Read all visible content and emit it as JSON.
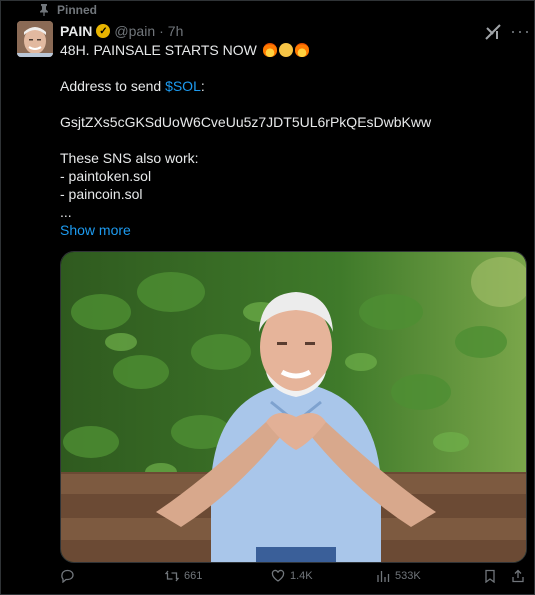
{
  "pinned": {
    "label": "Pinned"
  },
  "author": {
    "name": "PAIN",
    "handle": "@pain",
    "time": "7h"
  },
  "tweet": {
    "line1": "48H. PAINSALE STARTS NOW",
    "address_prefix": "Address to send ",
    "address_link": "$SOL",
    "address_suffix": ":",
    "address": "GsjtZXs5cGKSdUoW6CveUu5z7JDT5UL6rPkQEsDwbKww",
    "sns_intro": "These SNS also work:",
    "sns_1": "- paintoken.sol",
    "sns_2": "- paincoin.sol",
    "ellipsis": "...",
    "show_more": "Show more"
  },
  "metrics": {
    "reposts": "661",
    "likes": "1.4K",
    "views": "533K"
  },
  "colors": {
    "accent": "#1d9bf0",
    "muted": "#71767b",
    "verified": "#e8b400"
  },
  "icons": [
    "pin-icon",
    "verified-badge-icon",
    "grok-icon",
    "more-icon",
    "reply-icon",
    "repost-icon",
    "like-icon",
    "views-icon",
    "bookmark-icon",
    "share-icon"
  ]
}
